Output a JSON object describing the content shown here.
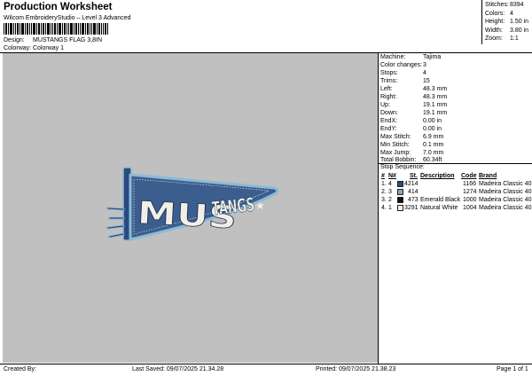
{
  "header": {
    "title": "Production Worksheet",
    "software": "Wilcom EmbroideryStudio – Level 3 Advanced",
    "design_label": "Design:",
    "design_value": "MUSTANGS FLAG 3,8IN",
    "colorway_label": "Colorway:",
    "colorway_value": "Colorway 1"
  },
  "summary": [
    {
      "label": "Stitches:",
      "value": "8394"
    },
    {
      "label": "Colors:",
      "value": "4"
    },
    {
      "label": "Height:",
      "value": "1.50 in"
    },
    {
      "label": "Width:",
      "value": "3.80 in"
    },
    {
      "label": "Zoom:",
      "value": "1:1"
    }
  ],
  "info": [
    {
      "label": "Machine:",
      "value": "Tajima"
    },
    {
      "label": "Color changes:",
      "value": "3"
    },
    {
      "label": "Stops:",
      "value": "4"
    },
    {
      "label": "Trims:",
      "value": "15"
    },
    {
      "label": "Left:",
      "value": "48.3 mm"
    },
    {
      "label": "Right:",
      "value": "48.3 mm"
    },
    {
      "label": "Up:",
      "value": "19.1 mm"
    },
    {
      "label": "Down:",
      "value": "19.1 mm"
    },
    {
      "label": "EndX:",
      "value": "0.00 in"
    },
    {
      "label": "EndY:",
      "value": "0.00 in"
    },
    {
      "label": "Max Stitch:",
      "value": "6.9 mm"
    },
    {
      "label": "Min Stitch:",
      "value": "0.1 mm"
    },
    {
      "label": "Max Jump:",
      "value": "7.0 mm"
    },
    {
      "label": "Total Bobbin:",
      "value": "60.34ft"
    }
  ],
  "stop_sequence": {
    "title": "Stop Sequence:",
    "headers": {
      "num": "#",
      "n": "N#",
      "st": "St.",
      "description": "Description",
      "code": "Code",
      "brand": "Brand"
    },
    "rows": [
      {
        "num": "1.",
        "n": "4",
        "color": "#2c4a7c",
        "st": "4214",
        "description": "",
        "code": "1166",
        "brand": "Madeira Classic 40"
      },
      {
        "num": "2.",
        "n": "3",
        "color": "#7aa8c8",
        "st": "414",
        "description": "",
        "code": "1274",
        "brand": "Madeira Classic 40"
      },
      {
        "num": "3.",
        "n": "2",
        "color": "#111111",
        "st": "473",
        "description": "Emerald Black",
        "code": "1000",
        "brand": "Madeira Classic 40"
      },
      {
        "num": "4.",
        "n": "1",
        "color": "#f2f0e6",
        "st": "3291",
        "description": "Natural White",
        "code": "1004",
        "brand": "Madeira Classic 40"
      }
    ]
  },
  "design": {
    "text": "MUSTANGS",
    "pennant_color": "#3b5e8e",
    "border_color": "#8bbad6",
    "text_color": "#f2f0e6",
    "star_glyph": "★"
  },
  "footer": {
    "created_by": "Created By:",
    "last_saved": "Last Saved: 09/07/2025 21.34.28",
    "printed": "Printed: 09/07/2025 21.38.23",
    "page": "Page 1 of 1"
  }
}
